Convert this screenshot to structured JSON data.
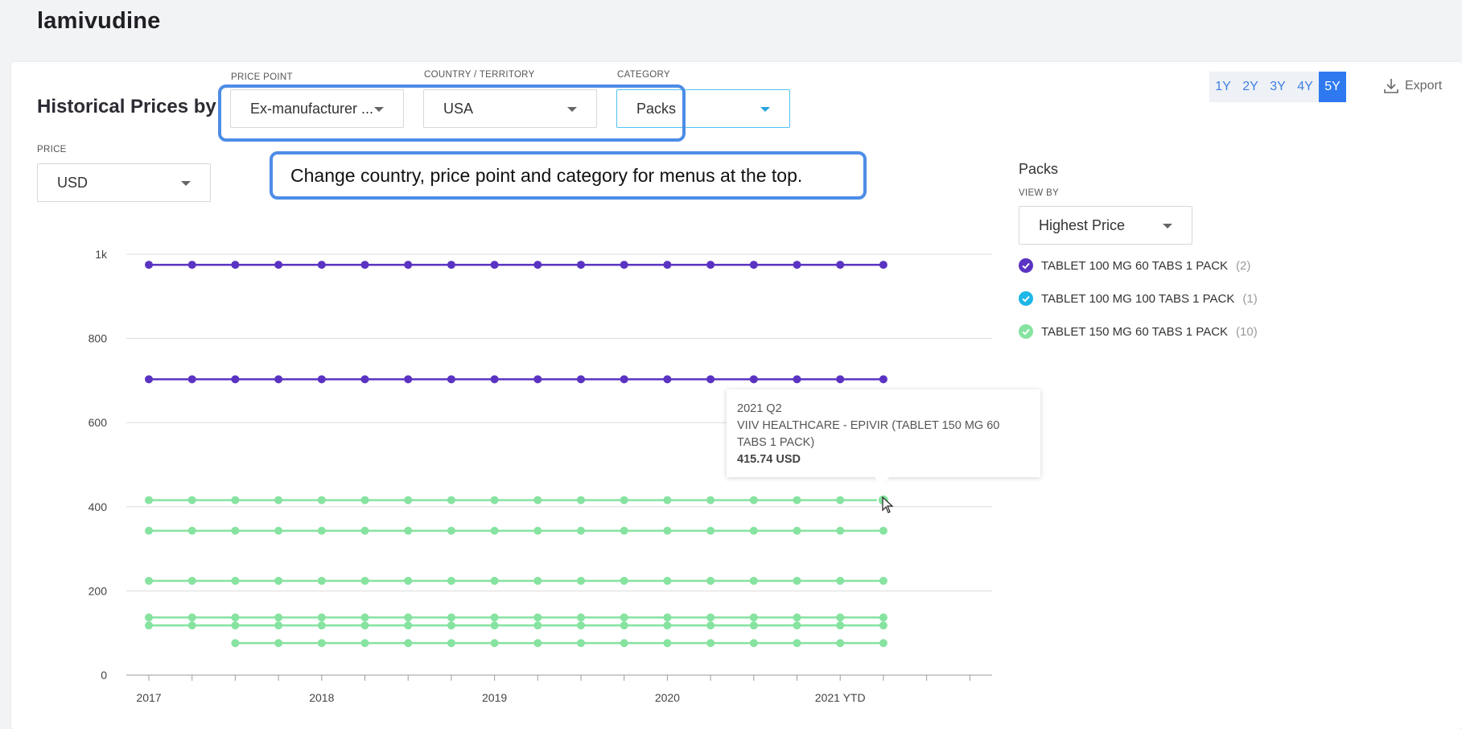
{
  "page_title": "lamivudine",
  "section_heading": "Historical Prices by",
  "filters": {
    "price_point": {
      "label": "PRICE POINT",
      "value": "Ex-manufacturer ..."
    },
    "country": {
      "label": "COUNTRY / TERRITORY",
      "value": "USA"
    },
    "category": {
      "label": "CATEGORY",
      "value": "Packs"
    },
    "price": {
      "label": "PRICE",
      "value": "USD"
    }
  },
  "annotation": "Change country,  price point and category for menus at the top.",
  "time_range": {
    "options": [
      "1Y",
      "2Y",
      "3Y",
      "4Y",
      "5Y"
    ],
    "selected": "5Y"
  },
  "export_label": "Export",
  "legend": {
    "title": "Packs",
    "view_by_label": "VIEW BY",
    "view_by_value": "Highest Price",
    "items": [
      {
        "label": "TABLET 100 MG 60 TABS 1 PACK",
        "count": "(2)",
        "color": "#5a33c2"
      },
      {
        "label": "TABLET 100 MG 100 TABS 1 PACK",
        "count": "(1)",
        "color": "#1db7e8"
      },
      {
        "label": "TABLET 150 MG 60 TABS 1 PACK",
        "count": "(10)",
        "color": "#86e3a0"
      }
    ]
  },
  "tooltip": {
    "period": "2021 Q2",
    "series": "VIIV HEALTHCARE - EPIVIR (TABLET 150 MG 60 TABS 1 PACK)",
    "value": "415.74 USD"
  },
  "chart_data": {
    "type": "line",
    "x_tick_labels": [
      "2017",
      "2018",
      "2019",
      "2020",
      "2021 YTD"
    ],
    "y_tick_labels": [
      "0",
      "200",
      "400",
      "600",
      "800",
      "1k"
    ],
    "ylim": [
      0,
      1000
    ],
    "x_quarters": [
      "2017 Q1",
      "2017 Q2",
      "2017 Q3",
      "2017 Q4",
      "2018 Q1",
      "2018 Q2",
      "2018 Q3",
      "2018 Q4",
      "2019 Q1",
      "2019 Q2",
      "2019 Q3",
      "2019 Q4",
      "2020 Q1",
      "2020 Q2",
      "2020 Q3",
      "2020 Q4",
      "2021 Q1",
      "2021 Q2"
    ],
    "grid": true,
    "series": [
      {
        "group": "TABLET 100 MG 60 TABS 1 PACK",
        "color": "#5a33c2",
        "value": 975,
        "start_index": 0
      },
      {
        "group": "TABLET 100 MG 60 TABS 1 PACK",
        "color": "#5a33c2",
        "value": 703,
        "start_index": 0
      },
      {
        "group": "TABLET 150 MG 60 TABS 1 PACK",
        "color": "#86e3a0",
        "value": 415.74,
        "start_index": 0
      },
      {
        "group": "TABLET 150 MG 60 TABS 1 PACK",
        "color": "#86e3a0",
        "value": 343,
        "start_index": 0
      },
      {
        "group": "TABLET 150 MG 60 TABS 1 PACK",
        "color": "#86e3a0",
        "value": 224,
        "start_index": 0
      },
      {
        "group": "TABLET 150 MG 60 TABS 1 PACK",
        "color": "#86e3a0",
        "value": 137,
        "start_index": 0
      },
      {
        "group": "TABLET 150 MG 60 TABS 1 PACK",
        "color": "#86e3a0",
        "value": 118,
        "start_index": 0
      },
      {
        "group": "TABLET 150 MG 60 TABS 1 PACK",
        "color": "#86e3a0",
        "value": 76,
        "start_index": 2
      }
    ]
  }
}
